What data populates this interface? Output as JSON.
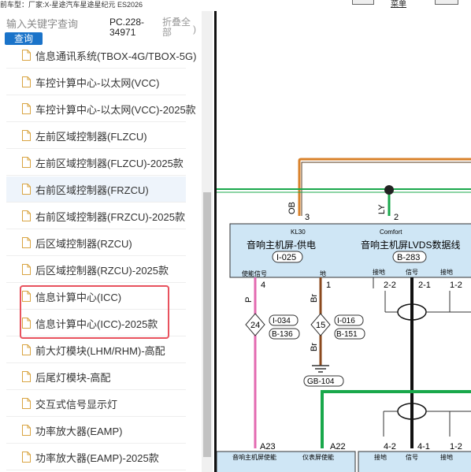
{
  "topbar": {
    "breadcrumb": "前车型：厂家:X-星途汽车星途星纪元 ES2026",
    "link": "菜单"
  },
  "search": {
    "placeholder": "输入关键字查询",
    "button": "查询",
    "part_code": "PC.228-34971",
    "collapse_all": "折叠全部",
    "collapse_paren": ")"
  },
  "list": {
    "items": [
      {
        "label": "信息通讯系统(TBOX-4G/TBOX-5G)"
      },
      {
        "label": "车控计算中心-以太网(VCC)"
      },
      {
        "label": "车控计算中心-以太网(VCC)-2025款"
      },
      {
        "label": "左前区域控制器(FLZCU)"
      },
      {
        "label": "左前区域控制器(FLZCU)-2025款"
      },
      {
        "label": "右前区域控制器(FRZCU)"
      },
      {
        "label": "右前区域控制器(FRZCU)-2025款"
      },
      {
        "label": "后区域控制器(RZCU)"
      },
      {
        "label": "后区域控制器(RZCU)-2025款"
      },
      {
        "label": "信息计算中心(ICC)"
      },
      {
        "label": "信息计算中心(ICC)-2025款"
      },
      {
        "label": "前大灯模块(LHM/RHM)-高配"
      },
      {
        "label": "后尾灯模块-高配"
      },
      {
        "label": "交互式信号显示灯"
      },
      {
        "label": "功率放大器(EAMP)"
      },
      {
        "label": "功率放大器(EAMP)-2025款"
      }
    ]
  },
  "diagram": {
    "wire_ob": "OB",
    "wire_ly": "LY",
    "pin_3": "3",
    "pin_2": "2",
    "kl30": "KL30",
    "comfort": "Comfort",
    "supply_title": "音响主机屏-供电",
    "supply_ref": "I-025",
    "lvds_title": "音响主机屏LVDS数据线",
    "lvds_ref": "B-283",
    "enable_signal": "使能信号",
    "ground_small": "地",
    "gnd_a": "接地",
    "signal_a": "信号",
    "gnd_b": "接地",
    "pin_4": "4",
    "pin_1": "1",
    "pin_2_2": "2-2",
    "pin_2_1": "2-1",
    "pin_1_2": "1-2",
    "wire_p": "P",
    "wire_br": "Br",
    "wire_br2": "Br",
    "splice_24": "24",
    "splice_15": "15",
    "ref_i034": "I-034",
    "ref_b136": "B-136",
    "ref_i016": "I-016",
    "ref_b151": "B-151",
    "ground_ref": "GB-104",
    "pin_a23": "A23",
    "pin_a22": "A22",
    "pin_4_2": "4-2",
    "pin_4_1": "4-1",
    "pin_1_2b": "1-2",
    "bottom_enable": "音响主机屏使能",
    "bottom_cluster": "仪表屏使能",
    "bottom_gnd": "接地",
    "bottom_signal": "信号",
    "bottom_gnd2": "接地"
  },
  "colors": {
    "accent": "#1a73c9",
    "highlight": "#e8525e",
    "connector_fill": "#cfe6f5",
    "wire_orange": "#d9822b",
    "wire_green": "#19a84b",
    "wire_pink": "#e36ab0",
    "wire_brown": "#8b4a1e"
  }
}
